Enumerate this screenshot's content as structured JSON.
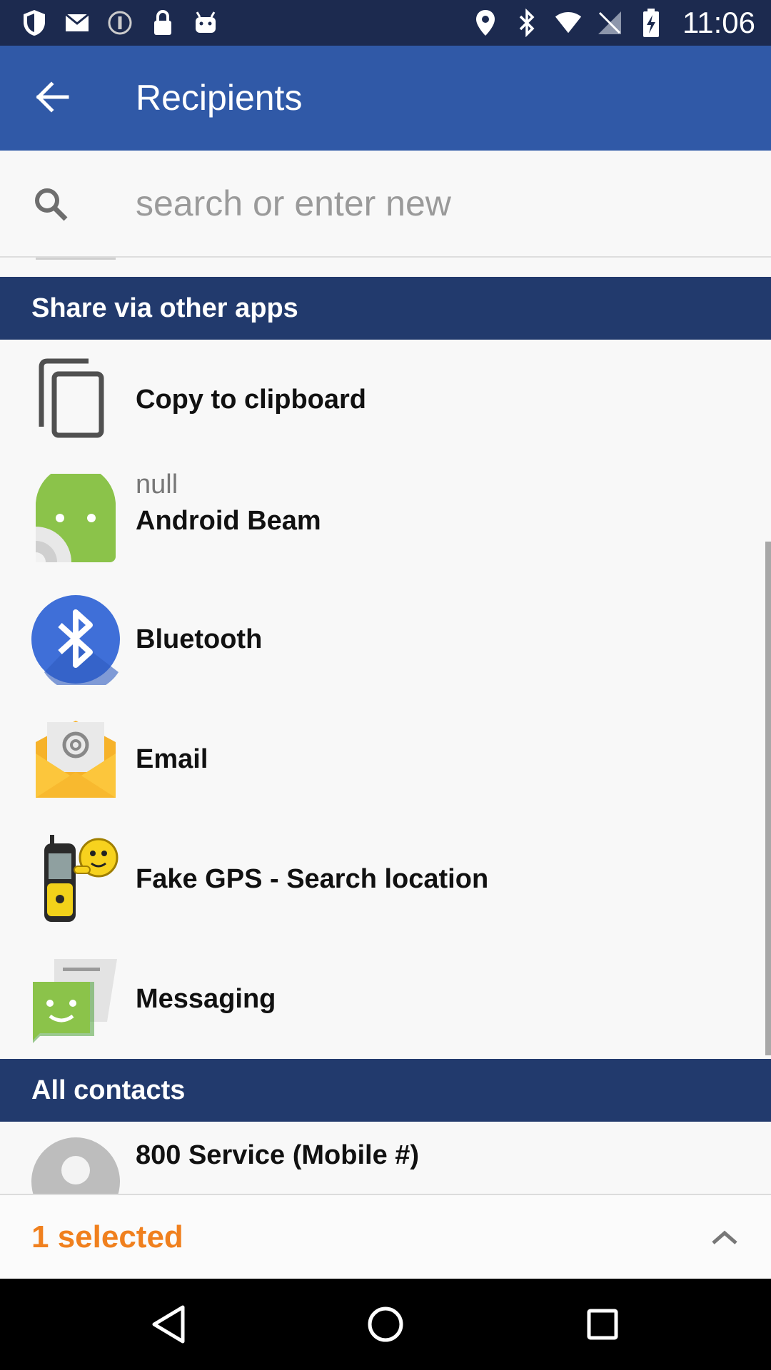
{
  "status_bar": {
    "time": "11:06",
    "left_icons": [
      "shield-icon",
      "mail-icon",
      "info-icon",
      "lock-icon",
      "android-icon"
    ],
    "right_icons": [
      "location-icon",
      "bluetooth-icon",
      "wifi-icon",
      "no-signal-icon",
      "battery-icon"
    ]
  },
  "app_bar": {
    "title": "Recipients",
    "back_icon": "arrow-back-icon"
  },
  "search": {
    "placeholder": "search or enter new",
    "icon": "search-icon"
  },
  "sections": {
    "share": "Share via other apps",
    "contacts": "All contacts"
  },
  "share_items": [
    {
      "label": "Copy to clipboard",
      "icon": "clipboard-copy-icon"
    },
    {
      "sublabel": "null",
      "label": "Android Beam",
      "icon": "android-beam-icon"
    },
    {
      "label": "Bluetooth",
      "icon": "bluetooth-app-icon"
    },
    {
      "label": "Email",
      "icon": "email-icon"
    },
    {
      "label": "Fake GPS - Search location",
      "icon": "fake-gps-icon"
    },
    {
      "label": "Messaging",
      "icon": "messaging-icon"
    }
  ],
  "contacts": [
    {
      "name": "800 Service (Mobile #)",
      "icon": "contact-avatar-icon"
    }
  ],
  "selection": {
    "label": "1 selected",
    "icon": "chevron-up-icon"
  },
  "navigation": {
    "back": "nav-back-icon",
    "home": "nav-home-icon",
    "recents": "nav-recents-icon"
  },
  "colors": {
    "status_bar": "#1c2a4f",
    "app_bar": "#3059a7",
    "section_header": "#223a6d",
    "selected_text": "#f0801e"
  }
}
